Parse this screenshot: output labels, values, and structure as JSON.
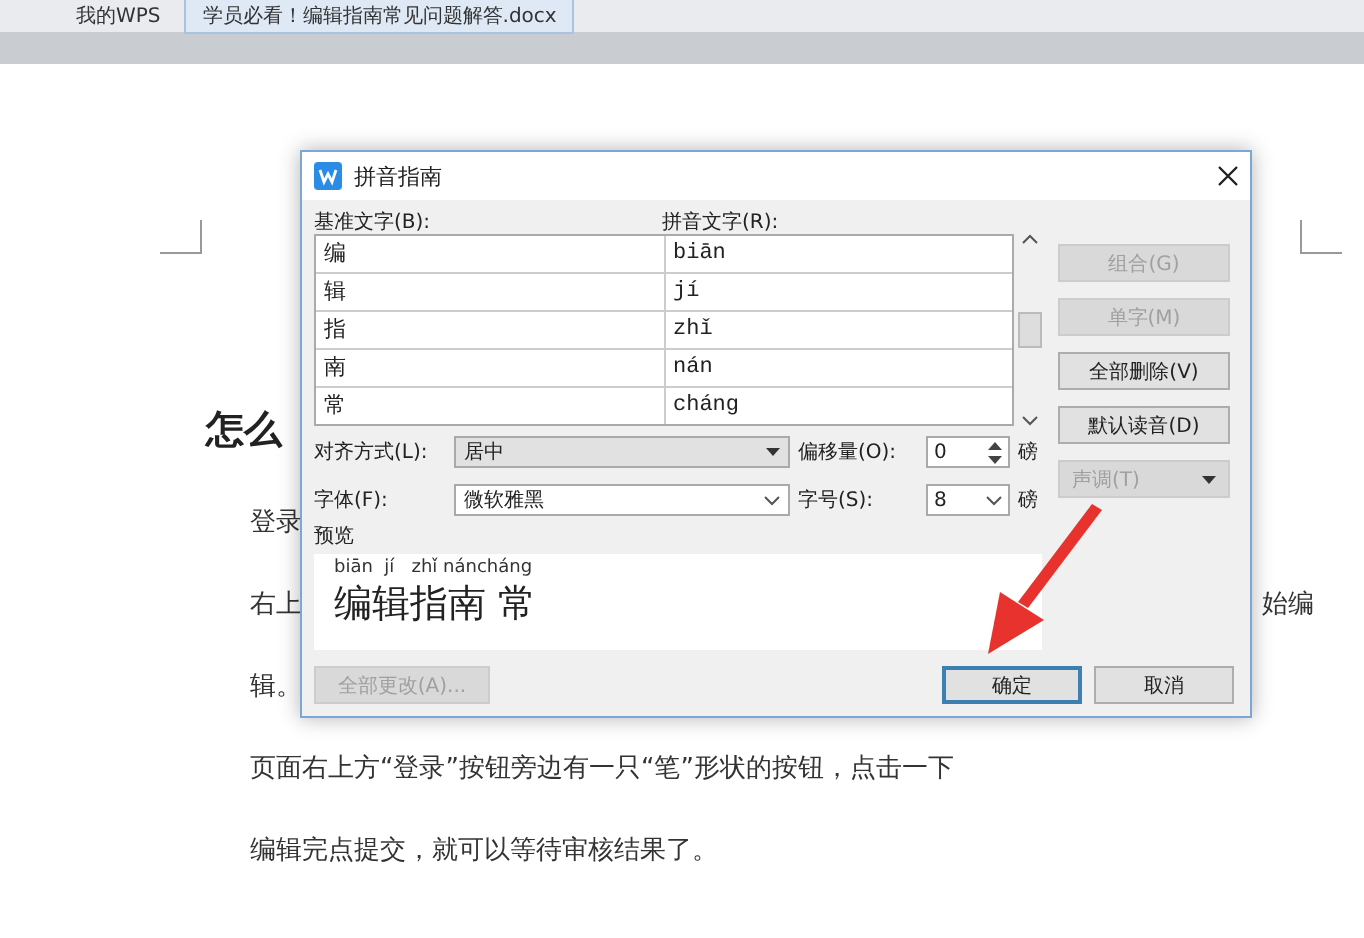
{
  "tabs": [
    {
      "label": "我的WPS",
      "selected": false
    },
    {
      "label": "学员必看！编辑指南常见问题解答.docx",
      "selected": true
    }
  ],
  "document": {
    "heading": "怎么",
    "lines": [
      {
        "left": "登录"
      },
      {
        "left": "右上",
        "right": "始编"
      },
      {
        "left": "辑。"
      },
      {
        "left": "页面右上方“登录”按钮旁边有一只“笔”形状的按钮，点击一下"
      },
      {
        "left": "编辑完点提交，就可以等待审核结果了。"
      }
    ]
  },
  "dialog": {
    "title": "拼音指南",
    "columns": [
      "基准文字(B):",
      "拼音文字(R):"
    ],
    "rows": [
      {
        "base": "编",
        "ruby": "biān"
      },
      {
        "base": "辑",
        "ruby": "jí"
      },
      {
        "base": "指",
        "ruby": "zhǐ"
      },
      {
        "base": "南",
        "ruby": "nán"
      },
      {
        "base": "常",
        "ruby": "cháng"
      }
    ],
    "side_buttons": [
      {
        "label": "组合(G)",
        "disabled": true,
        "kind": "button"
      },
      {
        "label": "单字(M)",
        "disabled": true,
        "kind": "button"
      },
      {
        "label": "全部删除(V)",
        "disabled": false,
        "kind": "button"
      },
      {
        "label": "默认读音(D)",
        "disabled": false,
        "kind": "button"
      },
      {
        "label": "声调(T)",
        "disabled": true,
        "kind": "dropdown"
      }
    ],
    "alignment": {
      "label": "对齐方式(L):",
      "value": "居中"
    },
    "offset": {
      "label": "偏移量(O):",
      "value": "0",
      "unit": "磅"
    },
    "font": {
      "label": "字体(F):",
      "value": "微软雅黑"
    },
    "size": {
      "label": "字号(S):",
      "value": "8",
      "unit": "磅"
    },
    "preview": {
      "label": "预览",
      "pinyin": "biān  jí   zhǐ náncháng",
      "text": "编辑指南 常"
    },
    "buttons": [
      {
        "label": "全部更改(A)...",
        "disabled": true,
        "default": false
      },
      {
        "label": "确定",
        "disabled": false,
        "default": true
      },
      {
        "label": "取消",
        "disabled": false,
        "default": false
      }
    ]
  }
}
